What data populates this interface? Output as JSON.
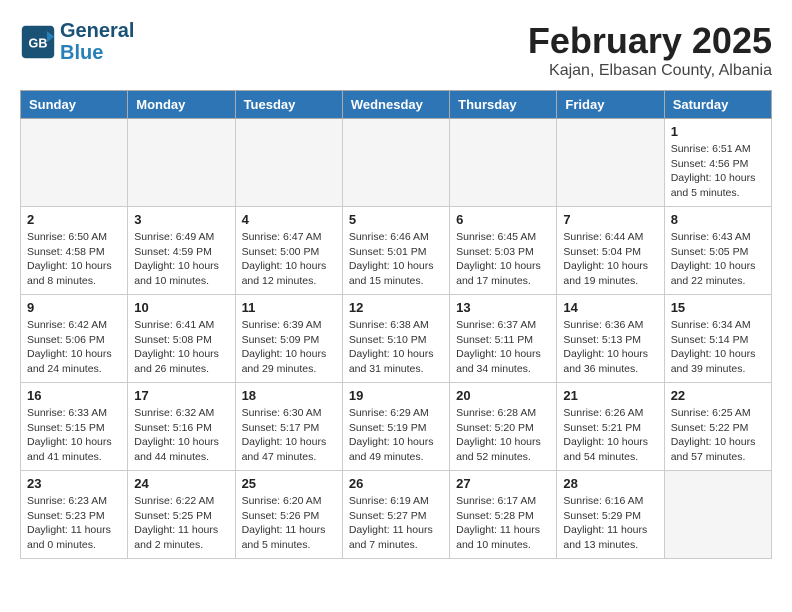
{
  "header": {
    "logo_general": "General",
    "logo_blue": "Blue",
    "month_title": "February 2025",
    "location": "Kajan, Elbasan County, Albania"
  },
  "weekdays": [
    "Sunday",
    "Monday",
    "Tuesday",
    "Wednesday",
    "Thursday",
    "Friday",
    "Saturday"
  ],
  "weeks": [
    [
      {
        "day": "",
        "info": ""
      },
      {
        "day": "",
        "info": ""
      },
      {
        "day": "",
        "info": ""
      },
      {
        "day": "",
        "info": ""
      },
      {
        "day": "",
        "info": ""
      },
      {
        "day": "",
        "info": ""
      },
      {
        "day": "1",
        "info": "Sunrise: 6:51 AM\nSunset: 4:56 PM\nDaylight: 10 hours and 5 minutes."
      }
    ],
    [
      {
        "day": "2",
        "info": "Sunrise: 6:50 AM\nSunset: 4:58 PM\nDaylight: 10 hours and 8 minutes."
      },
      {
        "day": "3",
        "info": "Sunrise: 6:49 AM\nSunset: 4:59 PM\nDaylight: 10 hours and 10 minutes."
      },
      {
        "day": "4",
        "info": "Sunrise: 6:47 AM\nSunset: 5:00 PM\nDaylight: 10 hours and 12 minutes."
      },
      {
        "day": "5",
        "info": "Sunrise: 6:46 AM\nSunset: 5:01 PM\nDaylight: 10 hours and 15 minutes."
      },
      {
        "day": "6",
        "info": "Sunrise: 6:45 AM\nSunset: 5:03 PM\nDaylight: 10 hours and 17 minutes."
      },
      {
        "day": "7",
        "info": "Sunrise: 6:44 AM\nSunset: 5:04 PM\nDaylight: 10 hours and 19 minutes."
      },
      {
        "day": "8",
        "info": "Sunrise: 6:43 AM\nSunset: 5:05 PM\nDaylight: 10 hours and 22 minutes."
      }
    ],
    [
      {
        "day": "9",
        "info": "Sunrise: 6:42 AM\nSunset: 5:06 PM\nDaylight: 10 hours and 24 minutes."
      },
      {
        "day": "10",
        "info": "Sunrise: 6:41 AM\nSunset: 5:08 PM\nDaylight: 10 hours and 26 minutes."
      },
      {
        "day": "11",
        "info": "Sunrise: 6:39 AM\nSunset: 5:09 PM\nDaylight: 10 hours and 29 minutes."
      },
      {
        "day": "12",
        "info": "Sunrise: 6:38 AM\nSunset: 5:10 PM\nDaylight: 10 hours and 31 minutes."
      },
      {
        "day": "13",
        "info": "Sunrise: 6:37 AM\nSunset: 5:11 PM\nDaylight: 10 hours and 34 minutes."
      },
      {
        "day": "14",
        "info": "Sunrise: 6:36 AM\nSunset: 5:13 PM\nDaylight: 10 hours and 36 minutes."
      },
      {
        "day": "15",
        "info": "Sunrise: 6:34 AM\nSunset: 5:14 PM\nDaylight: 10 hours and 39 minutes."
      }
    ],
    [
      {
        "day": "16",
        "info": "Sunrise: 6:33 AM\nSunset: 5:15 PM\nDaylight: 10 hours and 41 minutes."
      },
      {
        "day": "17",
        "info": "Sunrise: 6:32 AM\nSunset: 5:16 PM\nDaylight: 10 hours and 44 minutes."
      },
      {
        "day": "18",
        "info": "Sunrise: 6:30 AM\nSunset: 5:17 PM\nDaylight: 10 hours and 47 minutes."
      },
      {
        "day": "19",
        "info": "Sunrise: 6:29 AM\nSunset: 5:19 PM\nDaylight: 10 hours and 49 minutes."
      },
      {
        "day": "20",
        "info": "Sunrise: 6:28 AM\nSunset: 5:20 PM\nDaylight: 10 hours and 52 minutes."
      },
      {
        "day": "21",
        "info": "Sunrise: 6:26 AM\nSunset: 5:21 PM\nDaylight: 10 hours and 54 minutes."
      },
      {
        "day": "22",
        "info": "Sunrise: 6:25 AM\nSunset: 5:22 PM\nDaylight: 10 hours and 57 minutes."
      }
    ],
    [
      {
        "day": "23",
        "info": "Sunrise: 6:23 AM\nSunset: 5:23 PM\nDaylight: 11 hours and 0 minutes."
      },
      {
        "day": "24",
        "info": "Sunrise: 6:22 AM\nSunset: 5:25 PM\nDaylight: 11 hours and 2 minutes."
      },
      {
        "day": "25",
        "info": "Sunrise: 6:20 AM\nSunset: 5:26 PM\nDaylight: 11 hours and 5 minutes."
      },
      {
        "day": "26",
        "info": "Sunrise: 6:19 AM\nSunset: 5:27 PM\nDaylight: 11 hours and 7 minutes."
      },
      {
        "day": "27",
        "info": "Sunrise: 6:17 AM\nSunset: 5:28 PM\nDaylight: 11 hours and 10 minutes."
      },
      {
        "day": "28",
        "info": "Sunrise: 6:16 AM\nSunset: 5:29 PM\nDaylight: 11 hours and 13 minutes."
      },
      {
        "day": "",
        "info": ""
      }
    ]
  ]
}
